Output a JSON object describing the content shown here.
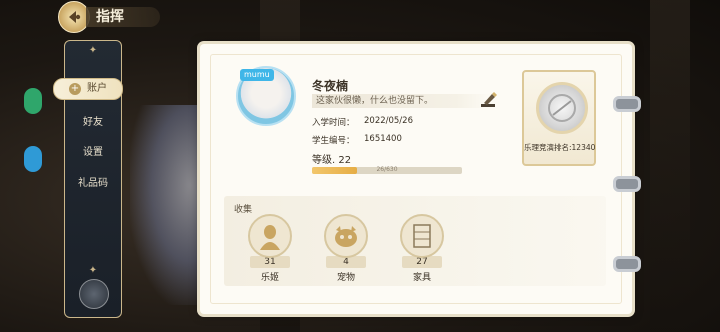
{
  "header": {
    "title": "指挥"
  },
  "sidebar": {
    "items": [
      {
        "label": "账户",
        "active": true
      },
      {
        "label": "好友",
        "active": false
      },
      {
        "label": "设置",
        "active": false
      },
      {
        "label": "礼品码",
        "active": false
      }
    ]
  },
  "profile": {
    "avatar_badge": "mumu",
    "name": "冬夜楠",
    "motto": "这家伙很懒，什么也没留下。",
    "enroll_label": "入学时间：",
    "enroll_date": "2022/05/26",
    "student_id_label": "学生编号：",
    "student_id": "1651400",
    "level_label": "等级. 22",
    "exp_text": "26/630",
    "exp_fraction": 0.3
  },
  "rank": {
    "text": "乐理竞演排名:12340"
  },
  "collection": {
    "title": "收集",
    "items": [
      {
        "count": "31",
        "label": "乐姬",
        "icon": "character-silhouette-icon"
      },
      {
        "count": "4",
        "label": "宠物",
        "icon": "pet-icon"
      },
      {
        "count": "27",
        "label": "家具",
        "icon": "furniture-icon"
      }
    ]
  },
  "colors": {
    "accent_gold": "#c9a561",
    "exp_fill": "#e6ad45",
    "panel_dark": "#1f252d"
  }
}
